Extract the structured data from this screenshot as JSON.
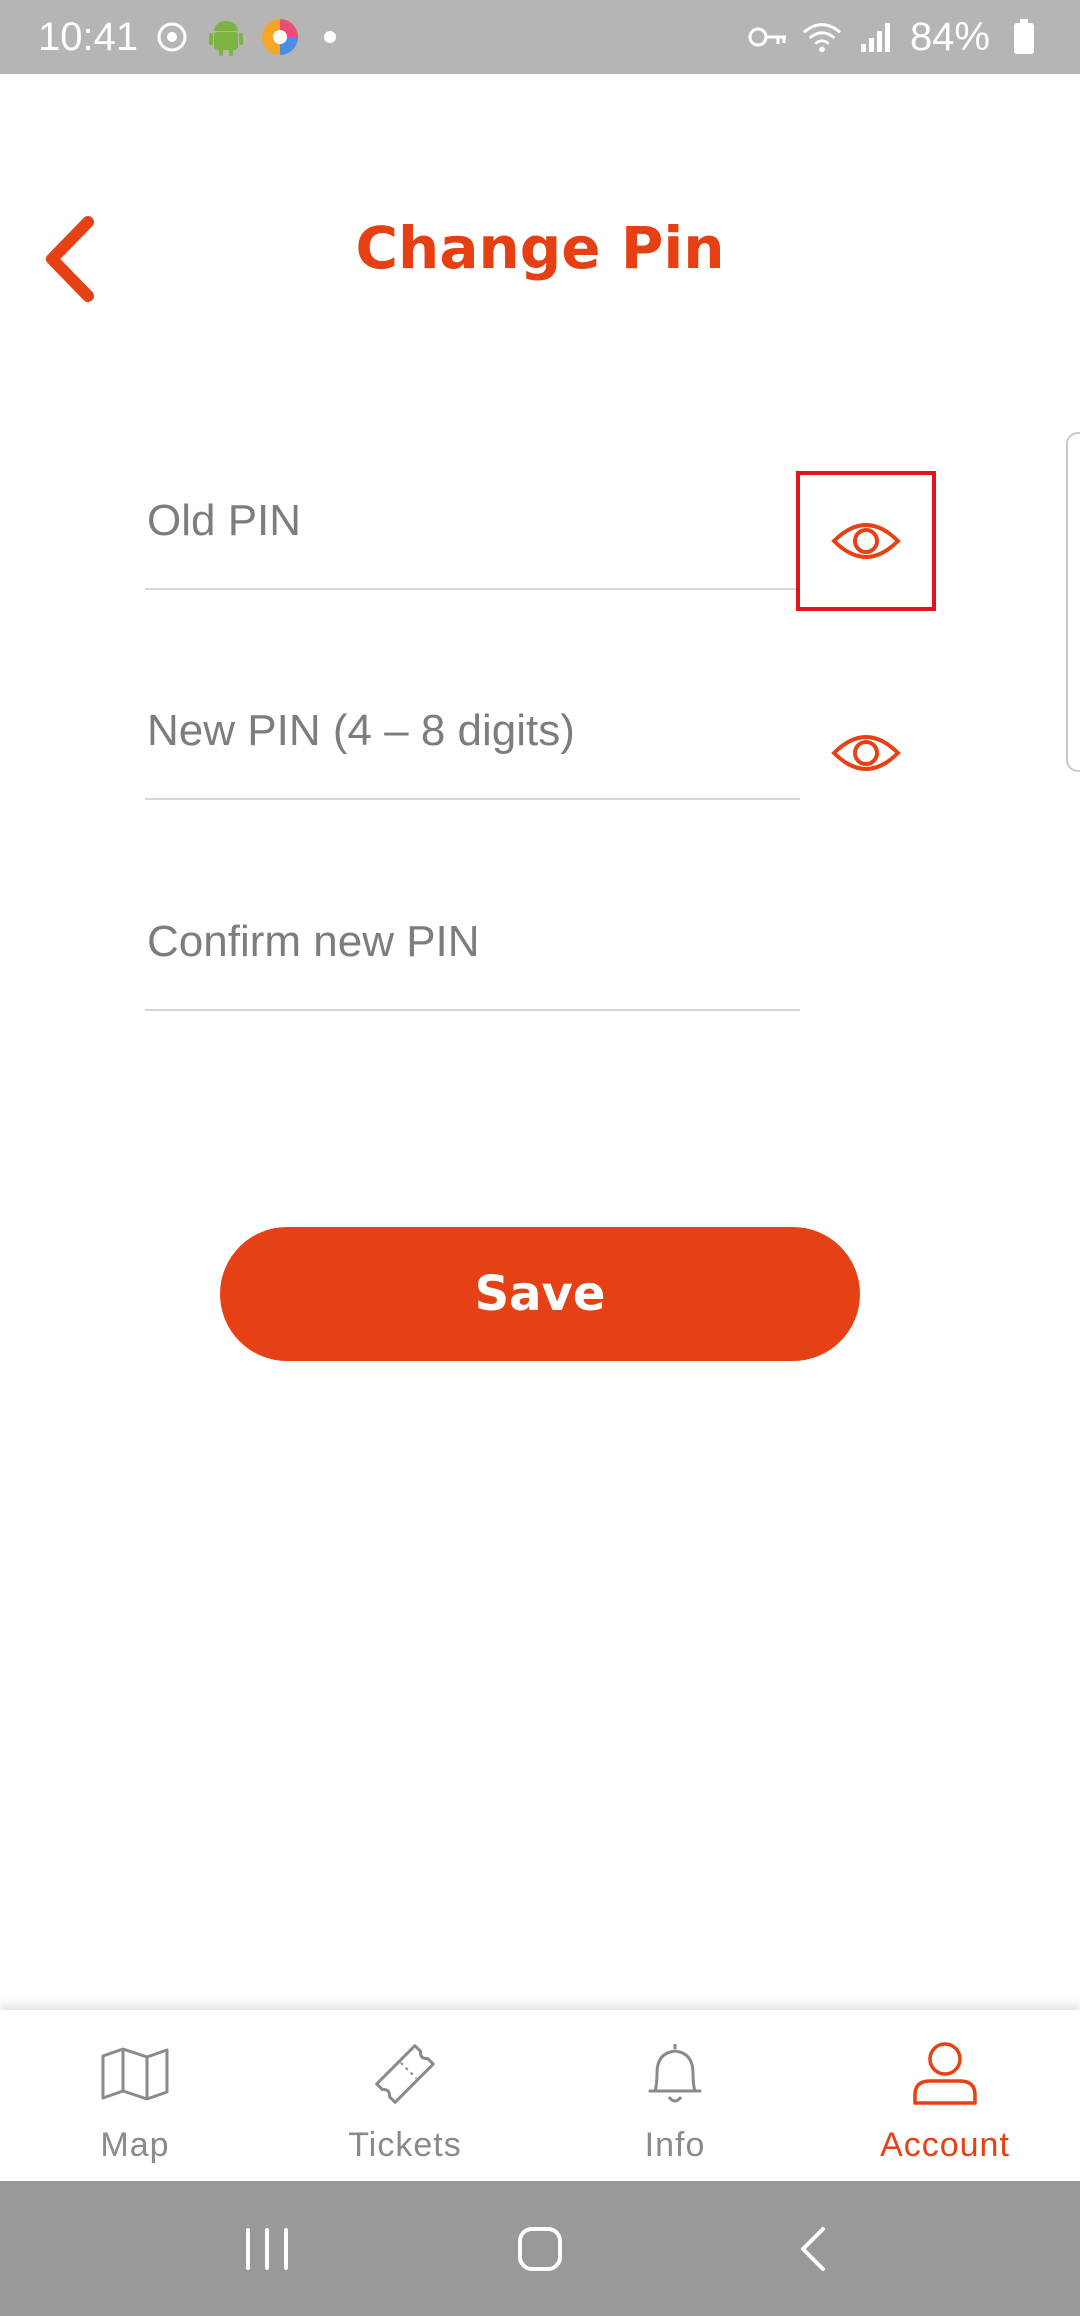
{
  "status_bar": {
    "time": "10:41",
    "battery": "84%",
    "icons": [
      "sync-icon",
      "android-icon",
      "app-icon",
      "key-icon",
      "wifi-icon",
      "signal-icon",
      "battery-icon"
    ]
  },
  "header": {
    "title": "Change Pin",
    "back_icon": "chevron-left-icon"
  },
  "form": {
    "old_pin": {
      "placeholder": "Old PIN",
      "value": ""
    },
    "new_pin": {
      "placeholder": "New PIN (4 – 8 digits)",
      "value": ""
    },
    "confirm_pin": {
      "placeholder": "Confirm new PIN",
      "value": ""
    },
    "eye_icon": "eye-icon"
  },
  "actions": {
    "save_label": "Save"
  },
  "bottom_nav": {
    "items": [
      {
        "label": "Map",
        "icon": "map-icon",
        "active": false
      },
      {
        "label": "Tickets",
        "icon": "ticket-icon",
        "active": false
      },
      {
        "label": "Info",
        "icon": "bell-icon",
        "active": false
      },
      {
        "label": "Account",
        "icon": "user-icon",
        "active": true
      }
    ]
  },
  "system_nav": {
    "buttons": [
      "recents-icon",
      "home-icon",
      "back-icon"
    ]
  },
  "colors": {
    "accent": "#e64115",
    "status_bar": "#b5b5b5",
    "system_nav": "#999999",
    "highlight_box": "#e3151a"
  }
}
